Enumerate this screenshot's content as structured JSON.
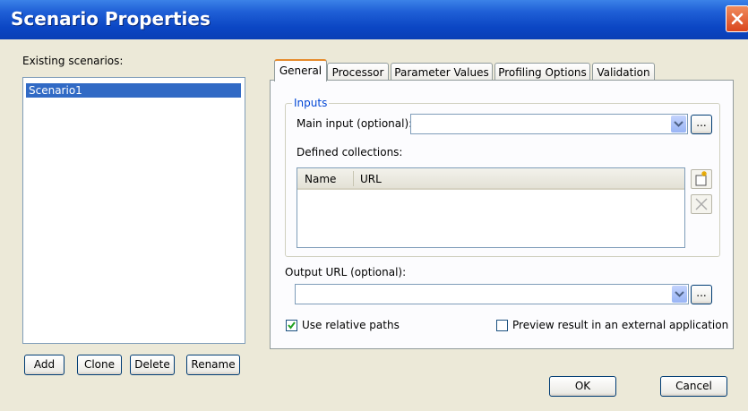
{
  "window": {
    "title": "Scenario Properties"
  },
  "scenarios": {
    "label": "Existing scenarios:",
    "items": [
      "Scenario1"
    ],
    "buttons": {
      "add": "Add",
      "clone": "Clone",
      "delete": "Delete",
      "rename": "Rename"
    }
  },
  "tabs": [
    "General",
    "Processor",
    "Parameter Values",
    "Profiling Options",
    "Validation"
  ],
  "active_tab": "General",
  "general": {
    "inputs_group": "Inputs",
    "main_input_label": "Main input (optional):",
    "main_input_value": "",
    "browse_label": "...",
    "defined_collections_label": "Defined collections:",
    "collections_columns": [
      "Name",
      "URL"
    ],
    "collections_rows": [],
    "output_url_label": "Output URL (optional):",
    "output_url_value": "",
    "use_relative_paths_label": "Use relative paths",
    "use_relative_paths_checked": true,
    "preview_external_label": "Preview result in an external application",
    "preview_external_checked": false
  },
  "footer": {
    "ok": "OK",
    "cancel": "Cancel"
  },
  "colors": {
    "title_bar": "#0a46c4",
    "selection": "#316ac5",
    "group_title": "#0046d5",
    "active_tab_accent": "#e68b2c",
    "close_button": "#d9461e"
  }
}
